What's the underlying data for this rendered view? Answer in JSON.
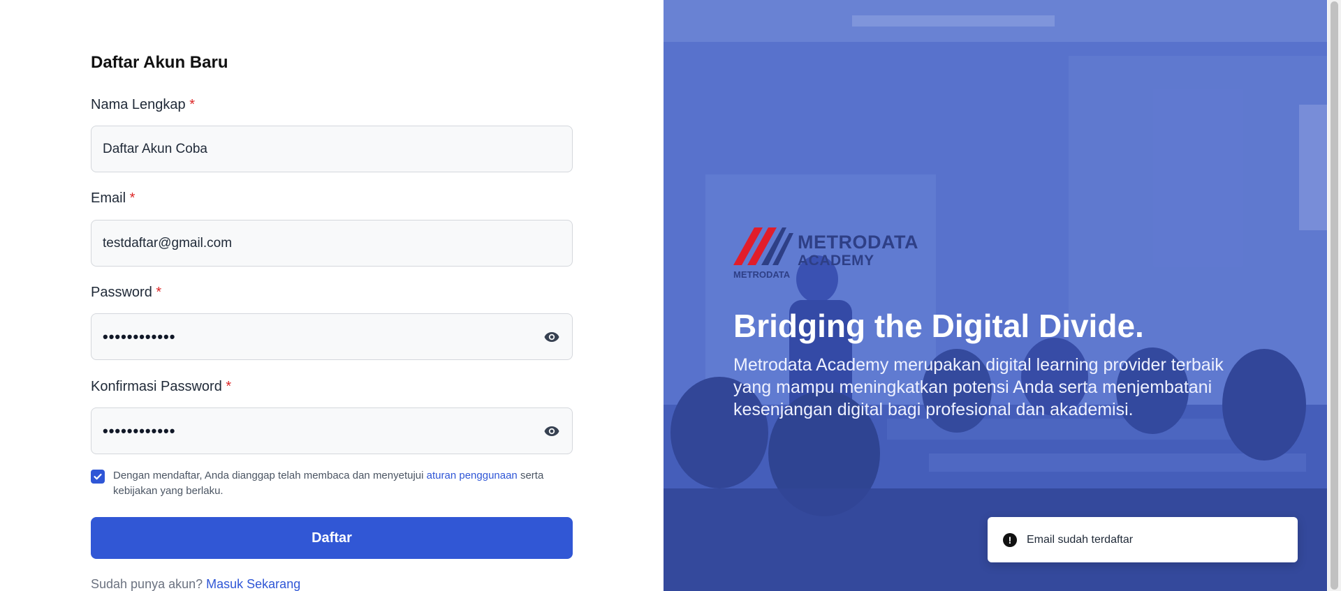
{
  "form": {
    "title": "Daftar Akun Baru",
    "name_label": "Nama Lengkap",
    "name_value": "Daftar Akun Coba",
    "email_label": "Email",
    "email_value": "testdaftar@gmail.com",
    "password_label": "Password",
    "password_value": "••••••••••••",
    "confirm_label": "Konfirmasi Password",
    "confirm_value": "••••••••••••",
    "required_mark": "*",
    "terms_prefix": "Dengan mendaftar, Anda dianggap telah membaca dan menyetujui ",
    "terms_link": "aturan penggunaan",
    "terms_suffix": " serta kebijakan yang berlaku.",
    "terms_checked": true,
    "submit_label": "Daftar",
    "login_prompt": "Sudah punya akun? ",
    "login_link": "Masuk Sekarang"
  },
  "hero": {
    "logo_line1": "METRODATA",
    "logo_line2": "ACADEMY",
    "logo_sub": "METRODATA",
    "title": "Bridging the Digital Divide.",
    "description": "Metrodata Academy merupakan digital learning provider terbaik yang mampu meningkatkan potensi Anda serta menjembatani kesenjangan digital bagi profesional dan akademisi."
  },
  "toast": {
    "message": "Email sudah terdaftar",
    "icon": "alert-circle-icon"
  },
  "colors": {
    "primary": "#3157d5",
    "required": "#dc2626",
    "hero_overlay": "#4f66bf"
  }
}
